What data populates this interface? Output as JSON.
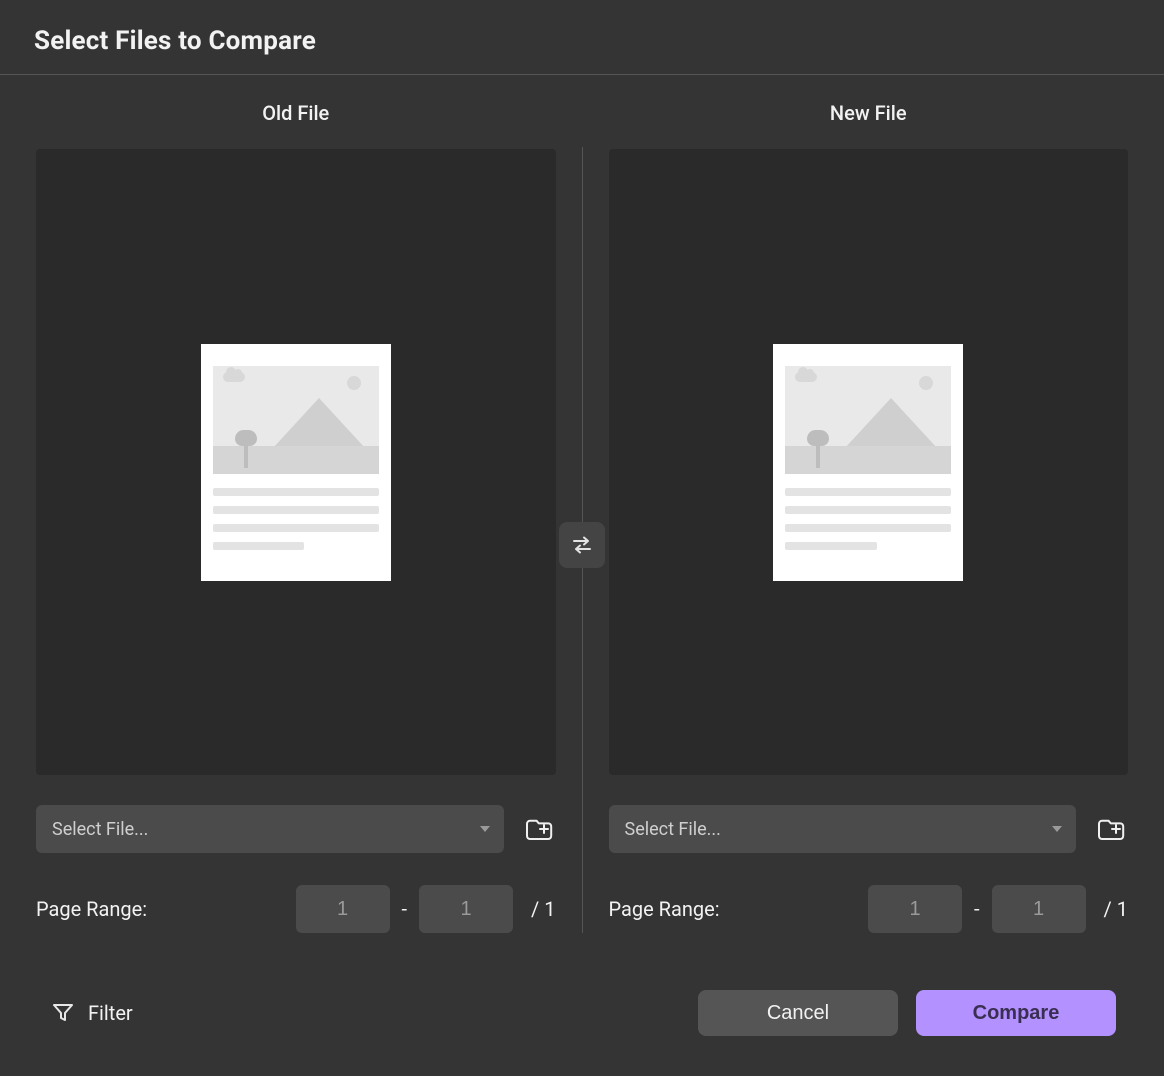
{
  "header": {
    "title": "Select Files to Compare"
  },
  "columns": {
    "old": {
      "title": "Old File",
      "select_placeholder": "Select File...",
      "range_label": "Page Range:",
      "range_from": "1",
      "range_to": "1",
      "range_sep": "-",
      "range_total": "/ 1"
    },
    "new": {
      "title": "New File",
      "select_placeholder": "Select File...",
      "range_label": "Page Range:",
      "range_from": "1",
      "range_to": "1",
      "range_sep": "-",
      "range_total": "/ 1"
    }
  },
  "swap_icon": "swap-horizontal",
  "folder_icon": "folder-open",
  "filter": {
    "icon": "funnel",
    "label": "Filter"
  },
  "footer": {
    "cancel": "Cancel",
    "compare": "Compare"
  }
}
